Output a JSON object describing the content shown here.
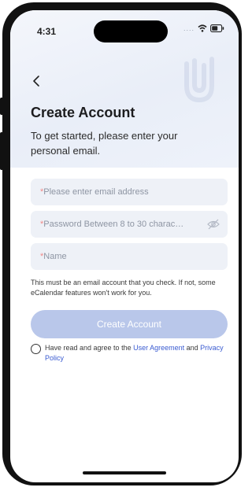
{
  "status_bar": {
    "time": "4:31",
    "signal": "....",
    "icons": [
      "wifi-icon",
      "battery-icon"
    ]
  },
  "header": {
    "back_icon": "chevron-left-icon",
    "logo_icon": "paperclip-logo",
    "title": "Create Account",
    "subtitle": "To get started, please enter your personal email."
  },
  "form": {
    "email": {
      "required_mark": "*",
      "placeholder": "Please enter email address"
    },
    "password": {
      "required_mark": "*",
      "placeholder": "Password Between 8 to 30 charac…",
      "toggle_icon": "eye-hidden-icon"
    },
    "name": {
      "required_mark": "*",
      "placeholder": "Name"
    },
    "note": "This must be an email account that you check. If not, some eCalendar features won't work for you.",
    "submit_label": "Create Account"
  },
  "agreement": {
    "prefix": "Have read and agree to the ",
    "user_agreement": "User Agreement",
    "middle": " and ",
    "privacy_policy": "Privacy Policy",
    "checked": false
  },
  "colors": {
    "accent": "#3a5bd1",
    "button_disabled": "#b9c7ea",
    "field_bg": "#eef1f7",
    "required": "#f08a8a"
  }
}
